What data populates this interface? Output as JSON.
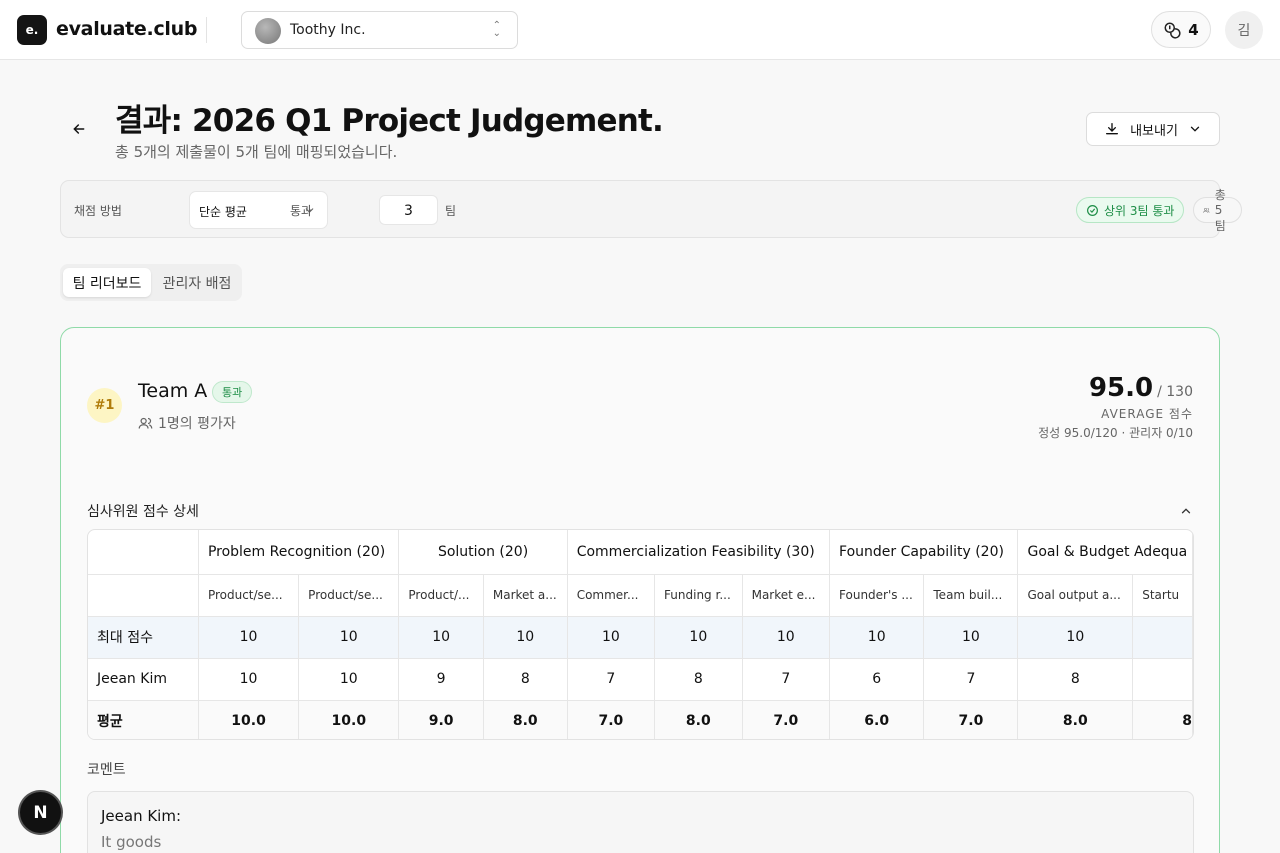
{
  "header": {
    "logo_mark": "e.",
    "logo_text": "evaluate.club",
    "org_name": "Toothy Inc.",
    "credits": "4",
    "user_initial": "김"
  },
  "page": {
    "title": "결과: 2026 Q1 Project Judgement.",
    "subtitle": "총 5개의 제출물이 5개 팀에 매핑되었습니다.",
    "export_label": "내보내기"
  },
  "filters": {
    "method_label": "채점 방법",
    "method_value": "단순 평균",
    "pass_label": "통과",
    "pass_value": "3",
    "pass_unit": "팀",
    "badge_pass": "상위 3팀 통과",
    "badge_total": "총 5팀"
  },
  "tabs": [
    {
      "label": "팀 리더보드"
    },
    {
      "label": "관리자 배점"
    }
  ],
  "team": {
    "rank": "#1",
    "name": "Team A",
    "status": "통과",
    "evaluators": "1명의 평가자",
    "score": "95.0",
    "score_max": "/ 130",
    "score_label": "AVERAGE 점수",
    "score_detail": "정성 95.0/120 · 관리자 0/10",
    "section_title": "심사위원 점수 상세",
    "comments_title": "코멘트",
    "comment_author": "Jeean Kim:",
    "comment_text": "It goods"
  },
  "table": {
    "groups": [
      {
        "label": "Problem Recognition (20)",
        "span": 2
      },
      {
        "label": "Solution (20)",
        "span": 2
      },
      {
        "label": "Commercialization Feasibility (30)",
        "span": 3
      },
      {
        "label": "Founder Capability (20)",
        "span": 2
      },
      {
        "label": "Goal & Budget Adequa",
        "span": 2
      }
    ],
    "subheaders": [
      "Product/se...",
      "Product/se...",
      "Product/...",
      "Market a...",
      "Commer...",
      "Funding r...",
      "Market e...",
      "Founder's ...",
      "Team buil...",
      "Goal output a...",
      "Startu"
    ],
    "rows": [
      {
        "label": "최대 점수",
        "values": [
          "10",
          "10",
          "10",
          "10",
          "10",
          "10",
          "10",
          "10",
          "10",
          "10",
          ""
        ]
      },
      {
        "label": "Jeean Kim",
        "values": [
          "10",
          "10",
          "9",
          "8",
          "7",
          "8",
          "7",
          "6",
          "7",
          "8",
          ""
        ]
      },
      {
        "label": "평균",
        "values": [
          "10.0",
          "10.0",
          "9.0",
          "8.0",
          "7.0",
          "8.0",
          "7.0",
          "6.0",
          "7.0",
          "8.0",
          "8"
        ]
      }
    ]
  },
  "dev": {
    "indicator": "N"
  },
  "colors": {
    "accent_green": "#1e8e47",
    "card_border": "#8fdaa8",
    "rank_bg": "#fdf5c4"
  }
}
